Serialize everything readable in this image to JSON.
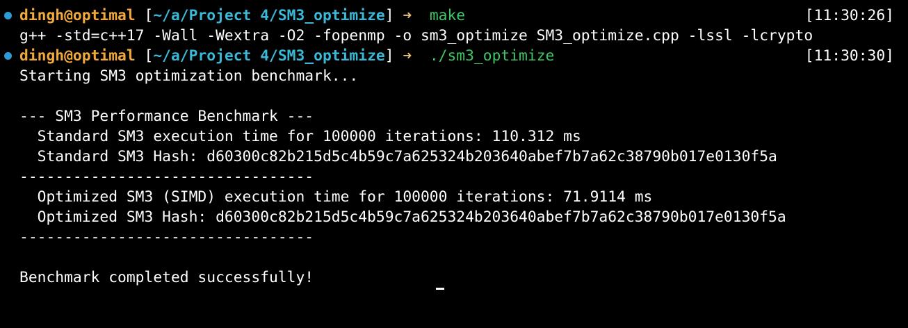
{
  "colors": {
    "background": "#000000",
    "text": "#ffffff",
    "user": "#f2a93b",
    "path": "#3ab8d8",
    "arrow": "#e5c07b",
    "command": "#3ec766",
    "prompt_dot": "#2e9bd6"
  },
  "prompts": [
    {
      "user_host": "dingh@optimal",
      "open_bracket": " [",
      "path": "~/a/Project 4/SM3_optimize",
      "close_bracket": "]",
      "arrow": " ➜  ",
      "command": "make",
      "timestamp": "[11:30:26]"
    },
    {
      "user_host": "dingh@optimal",
      "open_bracket": " [",
      "path": "~/a/Project 4/SM3_optimize",
      "close_bracket": "]",
      "arrow": " ➜  ",
      "command": "./sm3_optimize",
      "timestamp": "[11:30:30]"
    }
  ],
  "output": {
    "compile_line": "g++ -std=c++17 -Wall -Wextra -O2 -fopenmp -o sm3_optimize SM3_optimize.cpp -lssl -lcrypto",
    "lines": [
      "Starting SM3 optimization benchmark...",
      "",
      "--- SM3 Performance Benchmark ---",
      "  Standard SM3 execution time for 100000 iterations: 110.312 ms",
      "  Standard SM3 Hash: d60300c82b215d5c4b59c7a625324b203640abef7b7a62c38790b017e0130f5a",
      "---------------------------------",
      "  Optimized SM3 (SIMD) execution time for 100000 iterations: 71.9114 ms",
      "  Optimized SM3 Hash: d60300c82b215d5c4b59c7a625324b203640abef7b7a62c38790b017e0130f5a",
      "---------------------------------",
      "",
      "Benchmark completed successfully!"
    ]
  }
}
